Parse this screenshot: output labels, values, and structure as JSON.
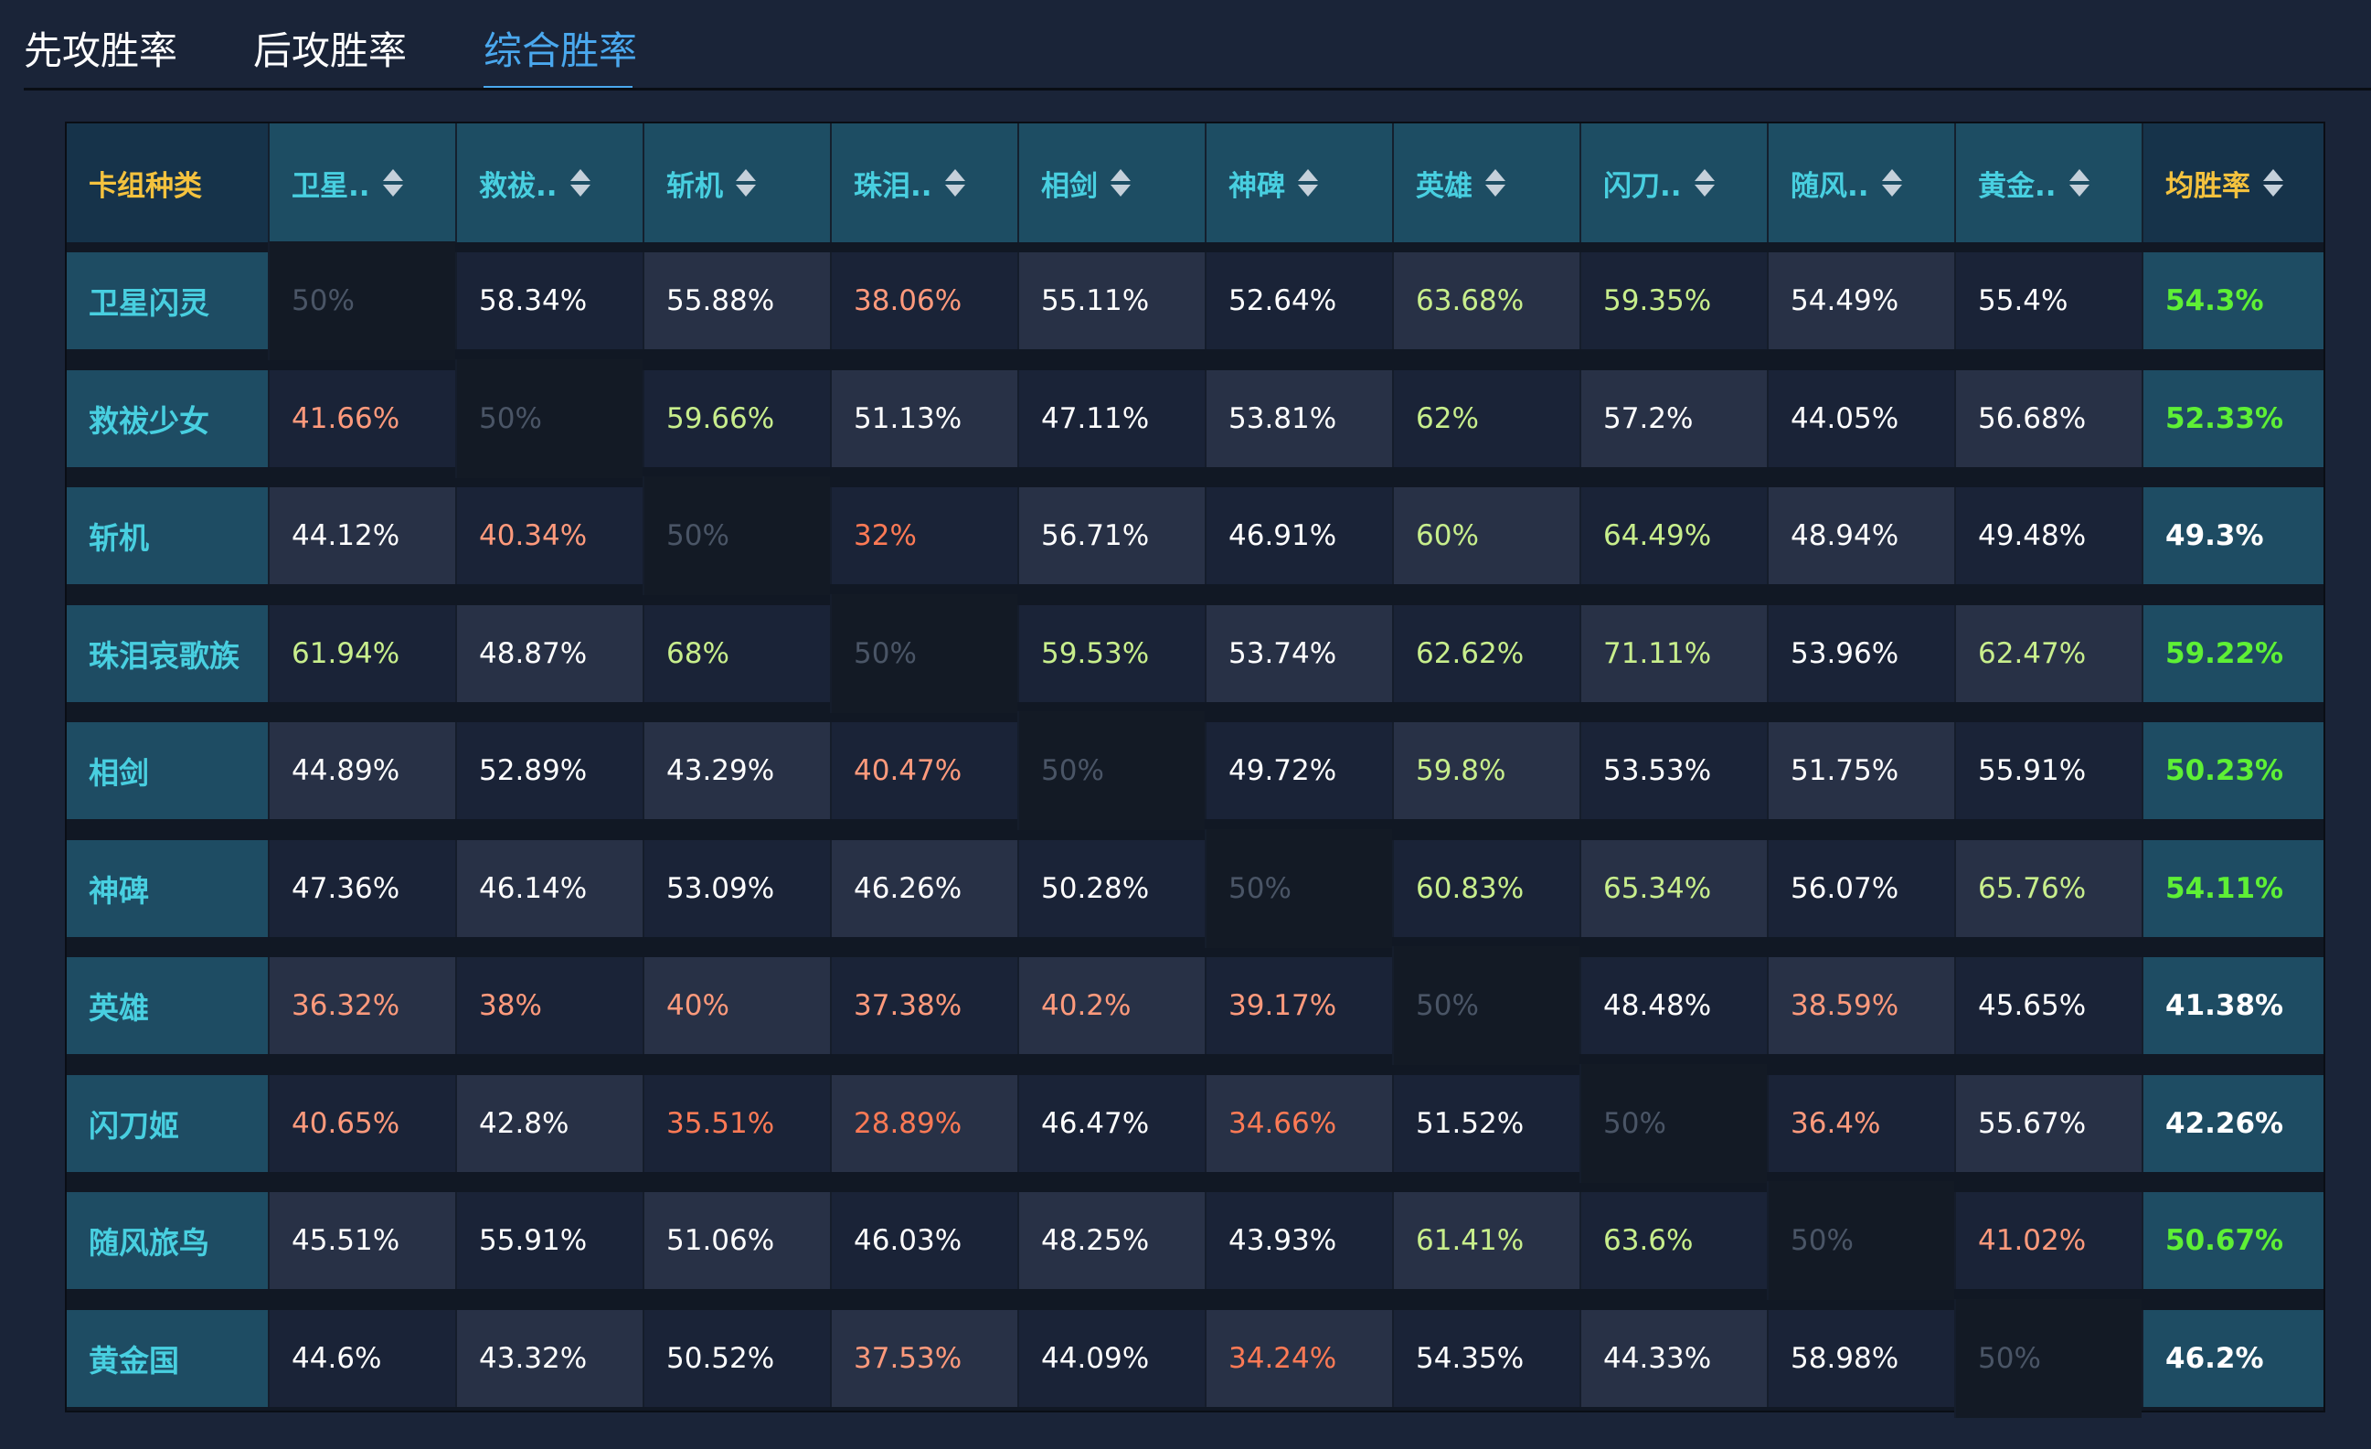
{
  "top_strip_text": "",
  "tabs": [
    "先攻胜率",
    "后攻胜率",
    "综合胜率"
  ],
  "active_tab": 2,
  "table": {
    "corner_label": "卡组种类",
    "columns": [
      "卫星..",
      "救祓..",
      "斩机",
      "珠泪..",
      "相剑",
      "神碑",
      "英雄",
      "闪刀..",
      "随风..",
      "黄金..",
      "均胜率"
    ],
    "rows": [
      {
        "name": "卫星闪灵",
        "values": [
          "50%",
          "58.34%",
          "55.88%",
          "38.06%",
          "55.11%",
          "52.64%",
          "63.68%",
          "59.35%",
          "54.49%",
          "55.4%"
        ],
        "avg": "54.3%"
      },
      {
        "name": "救祓少女",
        "values": [
          "41.66%",
          "50%",
          "59.66%",
          "51.13%",
          "47.11%",
          "53.81%",
          "62%",
          "57.2%",
          "44.05%",
          "56.68%"
        ],
        "avg": "52.33%"
      },
      {
        "name": "斩机",
        "values": [
          "44.12%",
          "40.34%",
          "50%",
          "32%",
          "56.71%",
          "46.91%",
          "60%",
          "64.49%",
          "48.94%",
          "49.48%"
        ],
        "avg": "49.3%"
      },
      {
        "name": "珠泪哀歌族",
        "values": [
          "61.94%",
          "48.87%",
          "68%",
          "50%",
          "59.53%",
          "53.74%",
          "62.62%",
          "71.11%",
          "53.96%",
          "62.47%"
        ],
        "avg": "59.22%"
      },
      {
        "name": "相剑",
        "values": [
          "44.89%",
          "52.89%",
          "43.29%",
          "40.47%",
          "50%",
          "49.72%",
          "59.8%",
          "53.53%",
          "51.75%",
          "55.91%"
        ],
        "avg": "50.23%"
      },
      {
        "name": "神碑",
        "values": [
          "47.36%",
          "46.14%",
          "53.09%",
          "46.26%",
          "50.28%",
          "50%",
          "60.83%",
          "65.34%",
          "56.07%",
          "65.76%"
        ],
        "avg": "54.11%"
      },
      {
        "name": "英雄",
        "values": [
          "36.32%",
          "38%",
          "40%",
          "37.38%",
          "40.2%",
          "39.17%",
          "50%",
          "48.48%",
          "38.59%",
          "45.65%"
        ],
        "avg": "41.38%"
      },
      {
        "name": "闪刀姬",
        "values": [
          "40.65%",
          "42.8%",
          "35.51%",
          "28.89%",
          "46.47%",
          "34.66%",
          "51.52%",
          "50%",
          "36.4%",
          "55.67%"
        ],
        "avg": "42.26%"
      },
      {
        "name": "随风旅鸟",
        "values": [
          "45.51%",
          "55.91%",
          "51.06%",
          "46.03%",
          "48.25%",
          "43.93%",
          "61.41%",
          "63.6%",
          "50%",
          "41.02%"
        ],
        "avg": "50.67%"
      },
      {
        "name": "黄金国",
        "values": [
          "44.6%",
          "43.32%",
          "50.52%",
          "37.53%",
          "44.09%",
          "34.24%",
          "54.35%",
          "44.33%",
          "58.98%",
          "50%"
        ],
        "avg": "46.2%"
      }
    ]
  },
  "colors": {
    "background": "#1a2438",
    "active_tab": "#4aa8ee",
    "header_bg": "#1d4d63",
    "row_label_bg": "#1e4c63",
    "label_text": "#48cfe0",
    "avg_header_text": "#f4c23e",
    "cell_light": "#283146",
    "cell_dark": "#1a2337",
    "cell_diagonal": "#131a25",
    "text_white": "#ffffff",
    "text_green": "#c8ee8c",
    "text_orange": "#ff9a7c",
    "text_red_orange": "#ff7a55",
    "text_dim": "#4a5566",
    "avg_green": "#5ef035"
  }
}
